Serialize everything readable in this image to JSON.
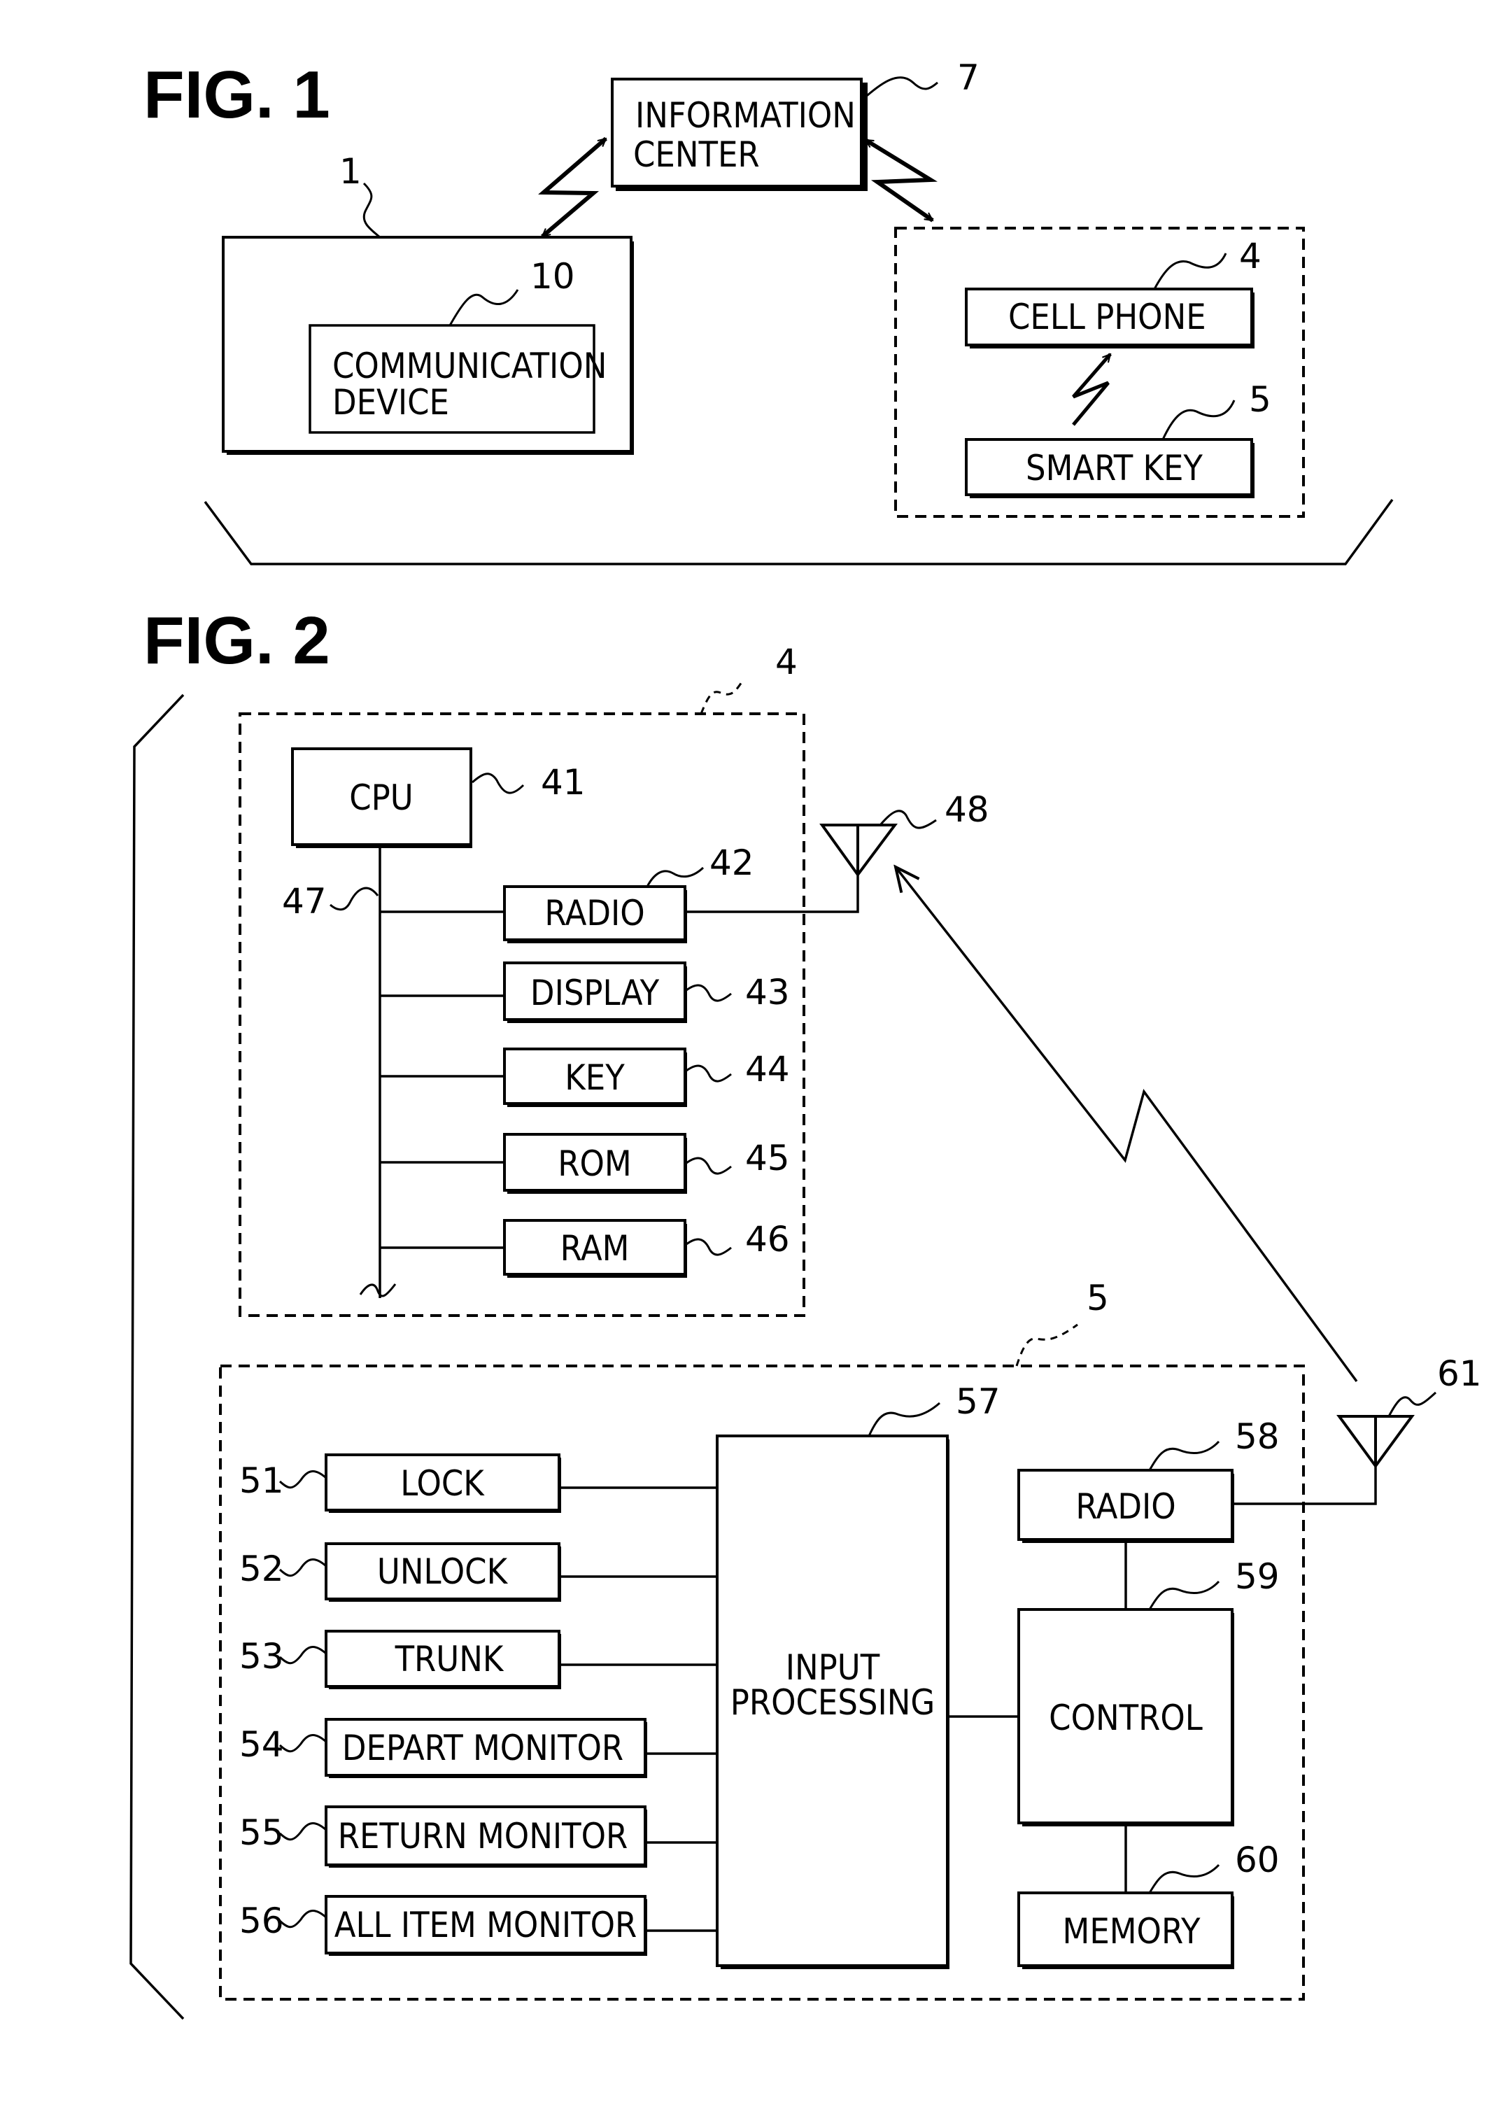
{
  "figures": [
    {
      "title": "FIG. 1",
      "blocks": {
        "information_center": {
          "lines": [
            "INFORMATION",
            "CENTER"
          ],
          "ref": "7"
        },
        "vehicle": {
          "ref": "1"
        },
        "communication_device": {
          "lines": [
            "COMMUNICATION",
            "DEVICE"
          ],
          "ref": "10"
        },
        "cell_phone": {
          "label": "CELL PHONE",
          "ref": "4"
        },
        "smart_key": {
          "label": "SMART KEY",
          "ref": "5"
        }
      }
    },
    {
      "title": "FIG. 2",
      "cell_phone": {
        "ref": "4",
        "cpu": {
          "label": "CPU",
          "ref": "41"
        },
        "bus_ref": "47",
        "antenna_ref": "48",
        "modules": [
          {
            "label": "RADIO",
            "ref": "42"
          },
          {
            "label": "DISPLAY",
            "ref": "43"
          },
          {
            "label": "KEY",
            "ref": "44"
          },
          {
            "label": "ROM",
            "ref": "45"
          },
          {
            "label": "RAM",
            "ref": "46"
          }
        ]
      },
      "smart_key": {
        "ref": "5",
        "switches": [
          {
            "label": "LOCK",
            "ref": "51"
          },
          {
            "label": "UNLOCK",
            "ref": "52"
          },
          {
            "label": "TRUNK",
            "ref": "53"
          },
          {
            "label": "DEPART MONITOR",
            "ref": "54"
          },
          {
            "label": "RETURN MONITOR",
            "ref": "55"
          },
          {
            "label": "ALL ITEM MONITOR",
            "ref": "56"
          }
        ],
        "input_processing": {
          "lines": [
            "INPUT",
            "PROCESSING"
          ],
          "ref": "57"
        },
        "radio": {
          "label": "RADIO",
          "ref": "58"
        },
        "control": {
          "label": "CONTROL",
          "ref": "59"
        },
        "memory": {
          "label": "MEMORY",
          "ref": "60"
        },
        "antenna_ref": "61"
      }
    }
  ]
}
